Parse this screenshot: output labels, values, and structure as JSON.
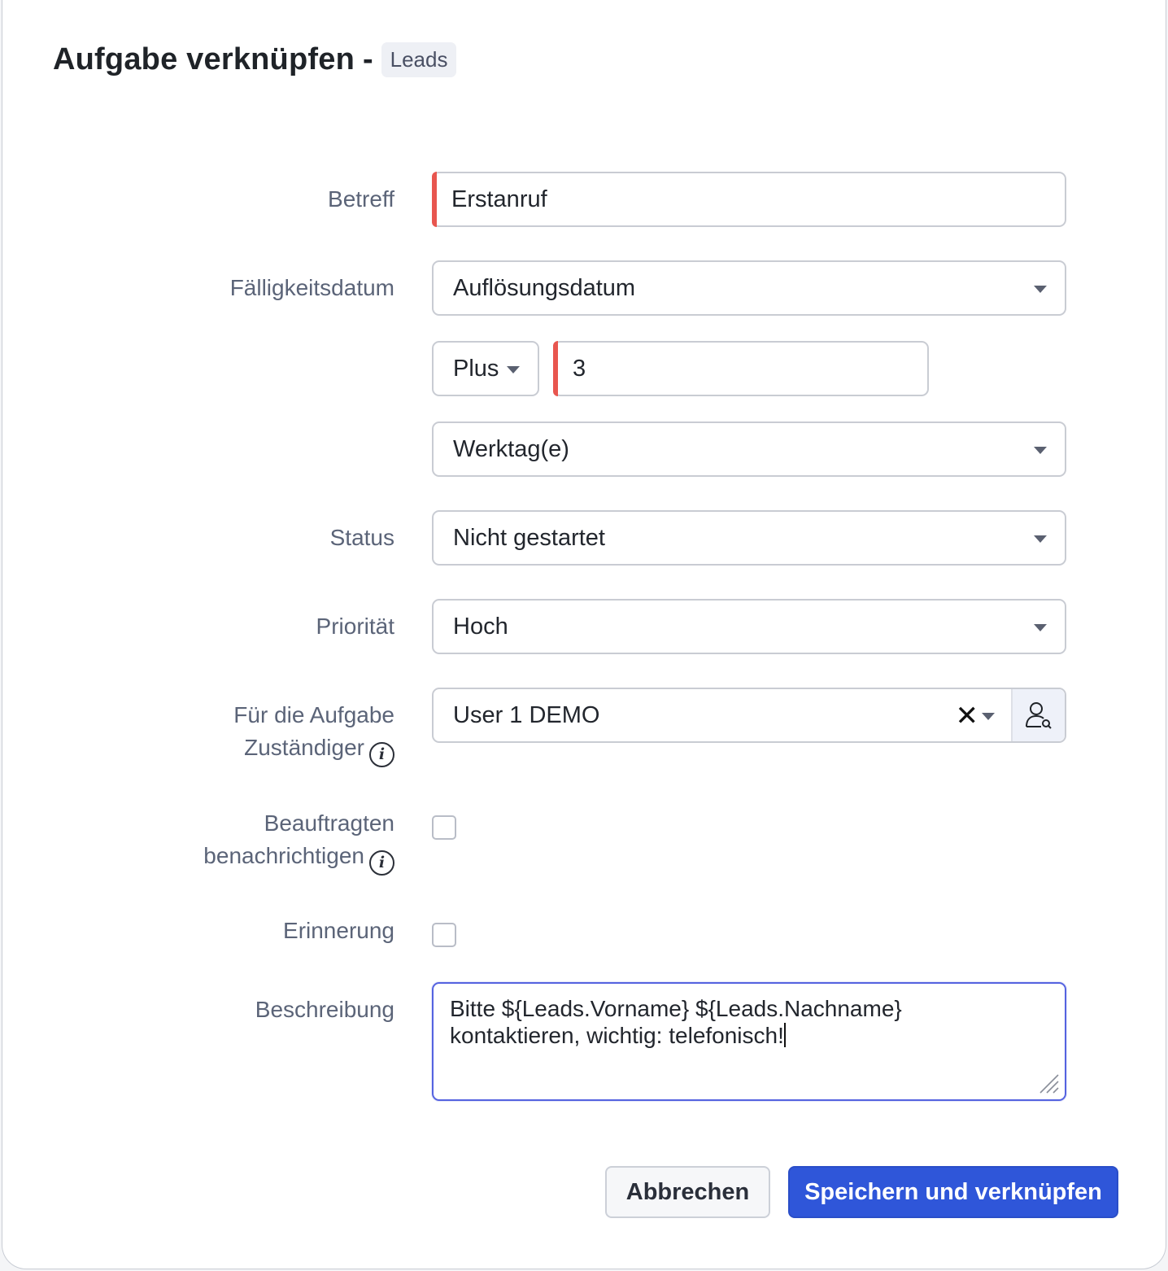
{
  "dialog": {
    "title": "Aufgabe verknüpfen",
    "separator": "-",
    "module_badge": "Leads"
  },
  "form": {
    "subject": {
      "label": "Betreff",
      "value": "Erstanruf"
    },
    "due_date": {
      "label": "Fälligkeitsdatum",
      "base": "Auflösungsdatum",
      "operator": "Plus",
      "amount": "3",
      "unit": "Werktag(e)"
    },
    "status": {
      "label": "Status",
      "value": "Nicht gestartet"
    },
    "priority": {
      "label": "Priorität",
      "value": "Hoch"
    },
    "assignee": {
      "label_line1": "Für die Aufgabe",
      "label_line2": "Zuständiger",
      "value": "User 1 DEMO",
      "clear_glyph": "✕",
      "icon": "user-search-icon"
    },
    "notify": {
      "label_line1": "Beauftragten",
      "label_line2": "benachrichtigen",
      "checked": false
    },
    "reminder": {
      "label": "Erinnerung",
      "checked": false
    },
    "description": {
      "label": "Beschreibung",
      "line1": "Bitte ${Leads.Vorname} ${Leads.Nachname}",
      "line2": "kontaktieren, wichtig: telefonisch!"
    }
  },
  "footer": {
    "cancel_label": "Abbrechen",
    "save_label": "Speichern und verknüpfen"
  },
  "colors": {
    "required_marker": "#e8564f",
    "primary": "#2f56d9",
    "focus_border": "#5563e0"
  }
}
